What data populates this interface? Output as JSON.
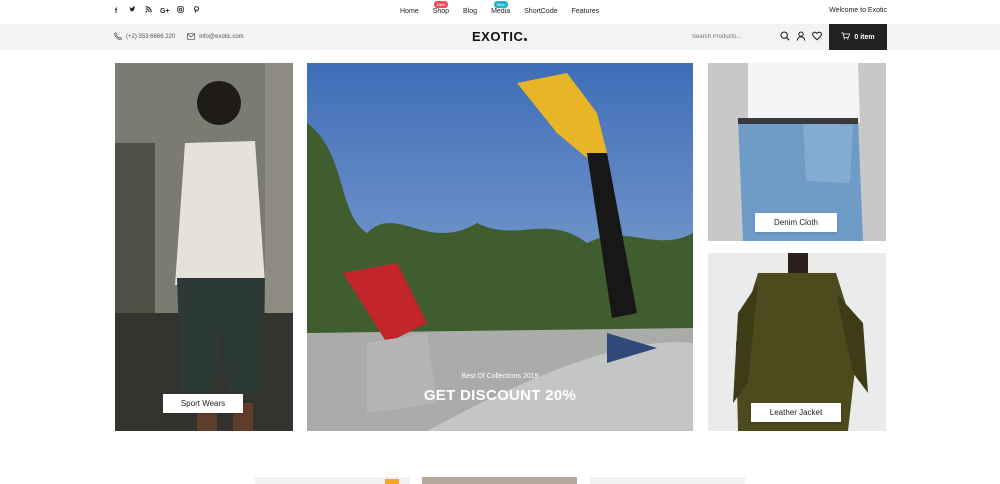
{
  "topbar": {
    "social": [
      "f",
      "t",
      "rss",
      "G+",
      "ig",
      "p"
    ],
    "nav": [
      {
        "label": "Home",
        "badge": null
      },
      {
        "label": "Shop",
        "badge": "New"
      },
      {
        "label": "Blog",
        "badge": null
      },
      {
        "label": "Media",
        "badge": "New"
      },
      {
        "label": "ShortCode",
        "badge": null
      },
      {
        "label": "Features",
        "badge": null
      }
    ],
    "welcome": "Welcome to Exotic"
  },
  "header": {
    "phone": "(+2) 353 6666 220",
    "email": "info@exotic.com",
    "logo": "EXOTIC",
    "search_placeholder": "Search Products...",
    "cart_label": "0 item"
  },
  "banners": {
    "sport": {
      "label": "Sport Wears"
    },
    "main": {
      "subtitle": "Best Of Collections 2019",
      "title": "GET DISCOUNT 20%"
    },
    "denim": {
      "label": "Denim Cloth"
    },
    "leather": {
      "label": "Leather Jacket"
    }
  },
  "colors": {
    "badge_shop": "#e8505b",
    "badge_media": "#22b5c9",
    "cart_bg": "#222222",
    "header_bg": "#f3f3f3"
  }
}
